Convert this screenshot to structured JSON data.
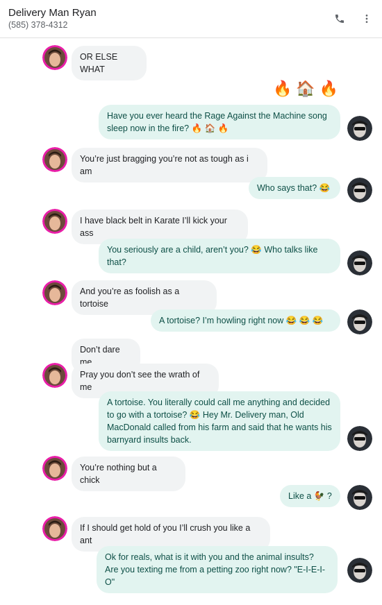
{
  "header": {
    "contact_name": "Delivery Man Ryan",
    "contact_phone": "(585) 378-4312",
    "call_icon": "phone-icon",
    "more_icon": "more-vert-icon"
  },
  "messages": [
    {
      "dir": "in",
      "text": "OR ELSE WHAT"
    },
    {
      "dir": "out-emoji",
      "text": "🔥🏠🔥"
    },
    {
      "dir": "out",
      "text": "Have you ever heard the Rage Against the Machine song sleep now in the fire? 🔥 🏠 🔥"
    },
    {
      "dir": "in",
      "text": "You’re just bragging you’re not as tough as i am"
    },
    {
      "dir": "out",
      "text": "Who says that? 😂"
    },
    {
      "dir": "in",
      "text": "I have black belt in Karate I’ll kick your ass"
    },
    {
      "dir": "out",
      "text": "You seriously are a child, aren’t you? 😂 Who talks like that?"
    },
    {
      "dir": "in",
      "text": "And you’re as foolish as a tortoise"
    },
    {
      "dir": "out",
      "text": "A tortoise?  I’m howling right now 😂 😂 😂"
    },
    {
      "dir": "in",
      "text": "Don’t dare me"
    },
    {
      "dir": "in",
      "text": "Pray you don’t see the wrath of me"
    },
    {
      "dir": "out",
      "text": "A tortoise. You literally could call me anything and decided to go with a tortoise? 😂  Hey Mr. Delivery man, Old MacDonald called from his farm and said that he wants his barnyard insults back."
    },
    {
      "dir": "in",
      "text": "You’re nothing but a chick"
    },
    {
      "dir": "out",
      "text": "Like a 🐓 ?"
    },
    {
      "dir": "in",
      "text": "If I should get hold of you I’ll crush you like a ant"
    },
    {
      "dir": "out",
      "text": "Ok for reals, what is it with you and the animal insults? Are you texting me from a petting zoo right now? \"E-I-E-I-O\""
    }
  ],
  "colors": {
    "incoming_bubble": "#f1f3f4",
    "outgoing_bubble": "#e2f4f0",
    "outgoing_text": "#0d4f46",
    "contact_avatar_ring": "#e91ea8"
  },
  "icons": {
    "contact_avatar": "contact-avatar",
    "self_avatar": "self-avatar"
  }
}
